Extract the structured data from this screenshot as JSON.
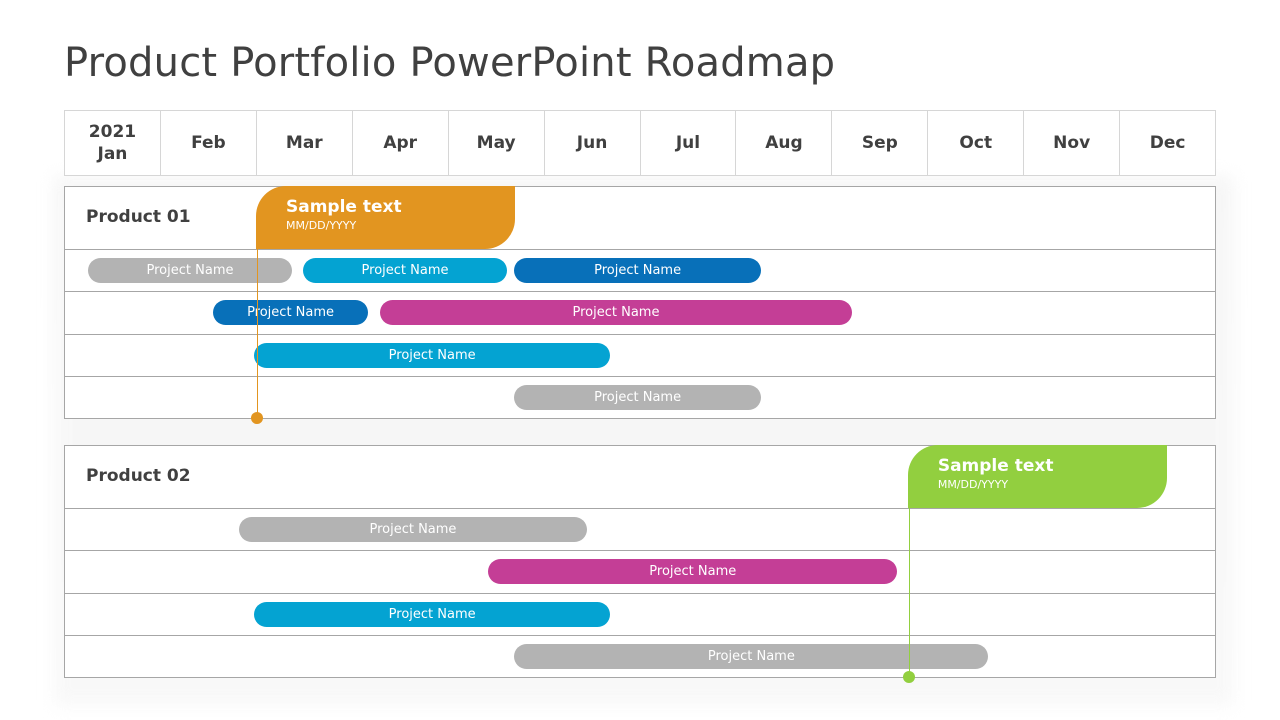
{
  "title": "Product Portfolio PowerPoint Roadmap",
  "chart_data": {
    "type": "gantt",
    "title": "Product Portfolio PowerPoint Roadmap",
    "year": "2021",
    "months": [
      "Jan",
      "Feb",
      "Mar",
      "Apr",
      "May",
      "Jun",
      "Jul",
      "Aug",
      "Sep",
      "Oct",
      "Nov",
      "Dec"
    ],
    "x_unit": "months from start of Jan 2021",
    "x_range": [
      0,
      12
    ],
    "colors": {
      "gray": "#b3b3b3",
      "cyan": "#04a3d2",
      "blue": "#0870b9",
      "magenta": "#c43e96",
      "orange": "#e29520",
      "green": "#92cf3f"
    },
    "products": [
      {
        "label": "Product 01",
        "milestone": {
          "title": "Sample text",
          "date": "MM/DD/YYYY",
          "at": 2.0,
          "box_end": 4.7,
          "color": "#e29520"
        },
        "rows": [
          [
            {
              "label": "Project Name",
              "start": 0.25,
              "end": 2.375,
              "color": "#b3b3b3"
            },
            {
              "label": "Project Name",
              "start": 2.49,
              "end": 4.615,
              "color": "#04a3d2"
            },
            {
              "label": "Project Name",
              "start": 4.69,
              "end": 7.26,
              "color": "#0870b9"
            }
          ],
          [
            {
              "label": "Project Name",
              "start": 1.55,
              "end": 3.17,
              "color": "#0870b9"
            },
            {
              "label": "Project Name",
              "start": 3.29,
              "end": 8.21,
              "color": "#c43e96"
            }
          ],
          [
            {
              "label": "Project Name",
              "start": 1.98,
              "end": 5.69,
              "color": "#04a3d2"
            }
          ],
          [
            {
              "label": "Project Name",
              "start": 4.69,
              "end": 7.26,
              "color": "#b3b3b3"
            }
          ]
        ]
      },
      {
        "label": "Product 02",
        "milestone": {
          "title": "Sample text",
          "date": "MM/DD/YYYY",
          "at": 8.79,
          "box_end": 11.49,
          "color": "#92cf3f"
        },
        "rows": [
          [
            {
              "label": "Project Name",
              "start": 1.82,
              "end": 5.45,
              "color": "#b3b3b3"
            }
          ],
          [
            {
              "label": "Project Name",
              "start": 4.42,
              "end": 8.68,
              "color": "#c43e96"
            }
          ],
          [
            {
              "label": "Project Name",
              "start": 1.98,
              "end": 5.69,
              "color": "#04a3d2"
            }
          ],
          [
            {
              "label": "Project Name",
              "start": 4.69,
              "end": 9.63,
              "color": "#b3b3b3"
            }
          ]
        ]
      }
    ]
  }
}
